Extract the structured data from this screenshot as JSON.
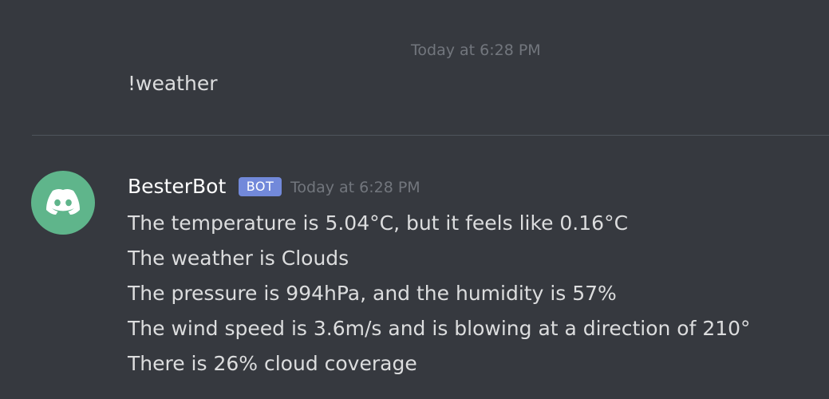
{
  "messages": {
    "user_message": {
      "timestamp": "Today at 6:28 PM",
      "text": "!weather"
    },
    "bot_message": {
      "avatar_icon": "discord-logo-icon",
      "avatar_color": "#5fb58b",
      "username": "BesterBot",
      "bot_tag": "BOT",
      "bot_tag_color": "#7289da",
      "timestamp": "Today at 6:28 PM",
      "lines": [
        "The temperature is 5.04°C, but it feels like 0.16°C",
        "The weather is Clouds",
        "The pressure is 994hPa, and the humidity is 57%",
        "The wind speed is 3.6m/s and is blowing at a direction of 210°",
        "There is 26% cloud coverage"
      ]
    }
  },
  "theme": {
    "background": "#36393f",
    "text": "#dcddde",
    "muted": "#72767d"
  }
}
